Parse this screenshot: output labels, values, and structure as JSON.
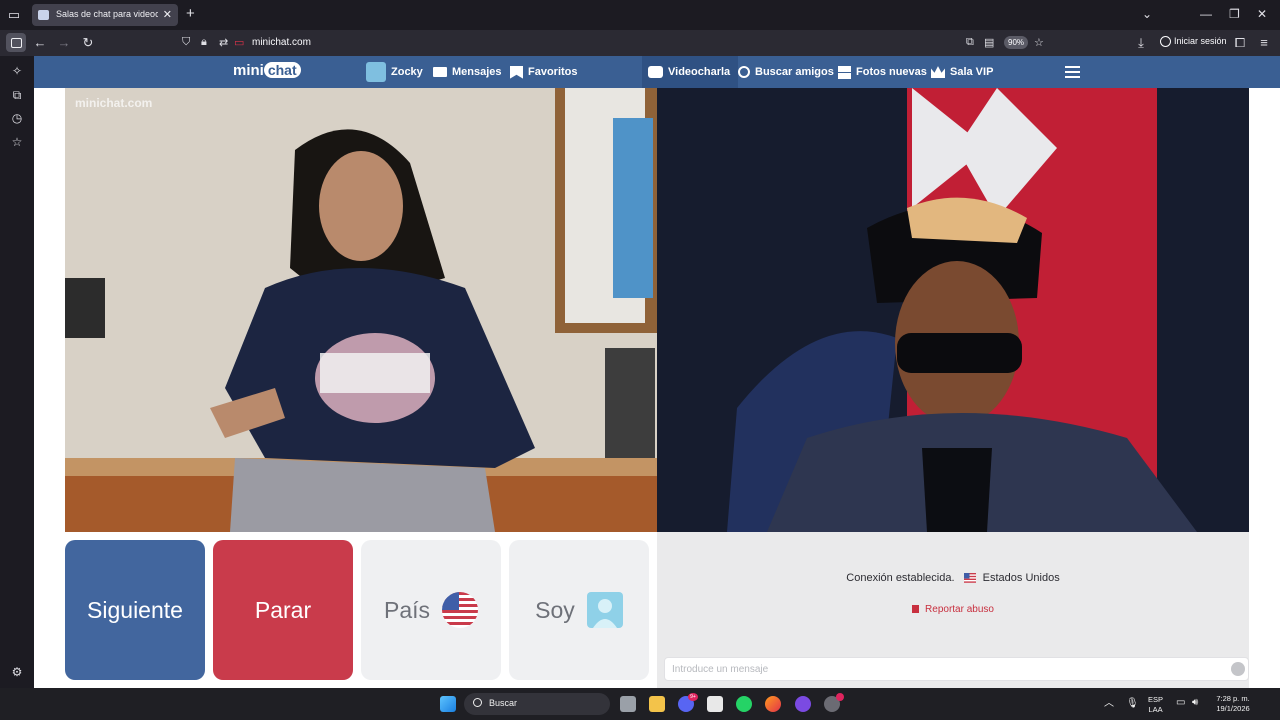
{
  "browser": {
    "tab_title": "Salas de chat para videocit",
    "new_tab": "+",
    "url": "minichat.com",
    "zoom": "90%",
    "signin_label": "Iniciar sesión"
  },
  "site": {
    "logo_mini": "mini",
    "logo_chat": "chat",
    "watermark": "minichat.com",
    "nav": {
      "user": "Zocky",
      "messages": "Mensajes",
      "favorites": "Favoritos",
      "videochat": "Videocharla",
      "find_friends": "Buscar amigos",
      "new_photos": "Fotos nuevas",
      "vip": "Sala VIP"
    }
  },
  "controls": {
    "next": "Siguiente",
    "stop": "Parar",
    "country": "País",
    "iam": "Soy"
  },
  "chat": {
    "status": "Conexión establecida.",
    "country": "Estados Unidos",
    "report": "Reportar abuso",
    "input_placeholder": "Introduce un mensaje"
  },
  "taskbar": {
    "search_label": "Buscar",
    "discord_badge": "9+",
    "lang_top": "ESP",
    "lang_bottom": "LAA",
    "time": "7:28 p. m.",
    "date": "19/1/2026"
  },
  "colors": {
    "nav_bg": "#3a5f93",
    "next_button": "#42669e",
    "stop_button": "#c93b4b",
    "report_red": "#c8303f"
  }
}
